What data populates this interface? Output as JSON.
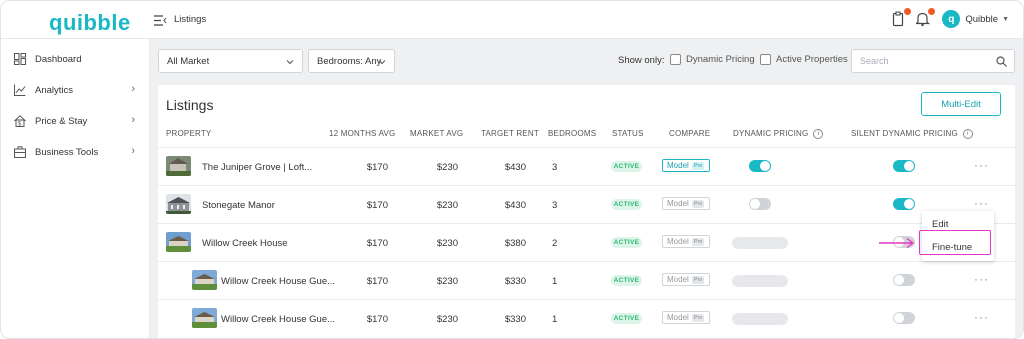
{
  "brand": {
    "logo": "quibble",
    "accent": "#1ab8c4",
    "highlight": "#e336c8"
  },
  "sidebar": {
    "items": [
      {
        "label": "Dashboard",
        "icon": "dashboard-icon",
        "has_chevron": false
      },
      {
        "label": "Analytics",
        "icon": "analytics-icon",
        "has_chevron": true
      },
      {
        "label": "Price & Stay",
        "icon": "price-stay-icon",
        "has_chevron": true
      },
      {
        "label": "Business Tools",
        "icon": "business-tools-icon",
        "has_chevron": true
      }
    ]
  },
  "topbar": {
    "breadcrumb": "Listings",
    "user_initial": "q",
    "user_name": "Quibble"
  },
  "filters": {
    "market": "All Market",
    "bedrooms": "Bedrooms: Any",
    "show_only_label": "Show only:",
    "dynamic_pricing_label": "Dynamic Pricing",
    "active_properties_label": "Active Properties",
    "search_placeholder": "Search"
  },
  "listings": {
    "title": "Listings",
    "multi_edit_label": "Multi-Edit",
    "columns": {
      "property": "PROPERTY",
      "months_avg": "12 MONTHS AVG",
      "market_avg": "MARKET AVG",
      "target_rent": "TARGET RENT",
      "bedrooms": "BEDROOMS",
      "status": "STATUS",
      "compare": "COMPARE",
      "dynamic_pricing": "DYNAMIC PRICING",
      "silent_dynamic_pricing": "SILENT DYNAMIC PRICING"
    },
    "rows": [
      {
        "name": "The Juniper Grove | Loft...",
        "months_avg": "$170",
        "market_avg": "$230",
        "target_rent": "$430",
        "bedrooms": "3",
        "status": "ACTIVE",
        "compare": "Model",
        "compare_badge": "Pro",
        "dynamic_pricing": "on",
        "silent_dynamic_pricing": "on"
      },
      {
        "name": "Stonegate Manor",
        "months_avg": "$170",
        "market_avg": "$230",
        "target_rent": "$430",
        "bedrooms": "3",
        "status": "ACTIVE",
        "compare": "Model",
        "compare_badge": "Pro",
        "dynamic_pricing": "off",
        "silent_dynamic_pricing": "on"
      },
      {
        "name": "Willow Creek House",
        "months_avg": "$170",
        "market_avg": "$230",
        "target_rent": "$380",
        "bedrooms": "2",
        "status": "ACTIVE",
        "compare": "Model",
        "compare_badge": "Pro",
        "dynamic_pricing": "disabled",
        "silent_dynamic_pricing": "off"
      },
      {
        "name": "Willow Creek House Gue...",
        "months_avg": "$170",
        "market_avg": "$230",
        "target_rent": "$330",
        "bedrooms": "1",
        "status": "ACTIVE",
        "compare": "Model",
        "compare_badge": "Pro",
        "dynamic_pricing": "disabled",
        "silent_dynamic_pricing": "off"
      },
      {
        "name": "Willow Creek House Gue...",
        "months_avg": "$170",
        "market_avg": "$230",
        "target_rent": "$330",
        "bedrooms": "1",
        "status": "ACTIVE",
        "compare": "Model",
        "compare_badge": "Pro",
        "dynamic_pricing": "disabled",
        "silent_dynamic_pricing": "off"
      }
    ]
  },
  "row_menu": {
    "edit_label": "Edit",
    "fine_tune_label": "Fine-tune"
  }
}
